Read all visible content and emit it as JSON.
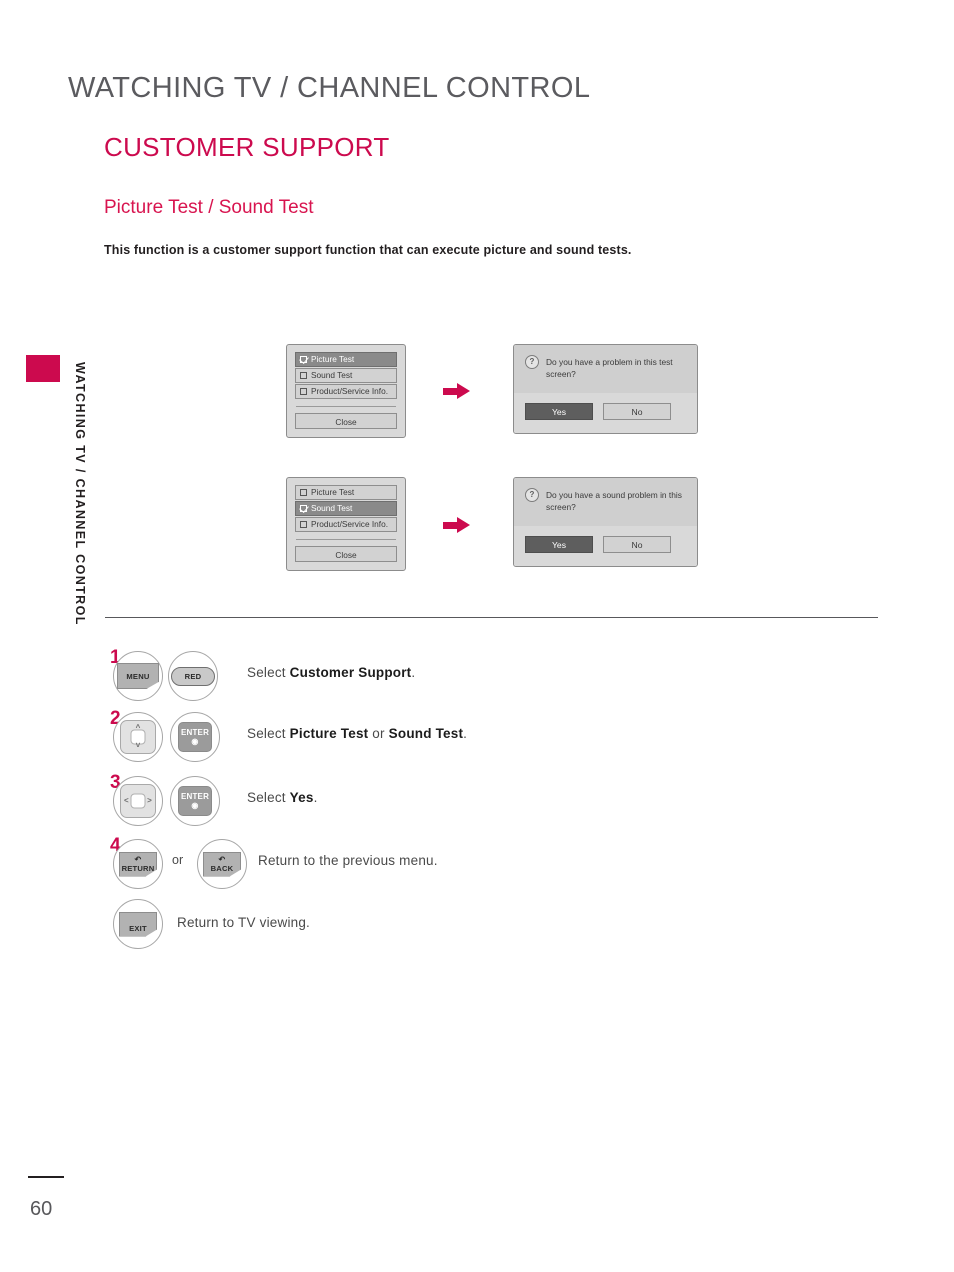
{
  "header": {
    "chapter_title": "WATCHING TV / CHANNEL CONTROL",
    "section_title": "CUSTOMER SUPPORT",
    "sub_title": "Picture Test  / Sound Test",
    "intro_text": "This function is a customer support function that can execute picture and sound tests."
  },
  "sidebar": {
    "label": "WATCHING TV / CHANNEL CONTROL",
    "tab_color": "#cc0a4e"
  },
  "osd": {
    "menu_picture": {
      "rows": [
        {
          "label": "Picture Test",
          "checked": true,
          "selected": true
        },
        {
          "label": "Sound Test",
          "checked": false,
          "selected": false
        },
        {
          "label": "Product/Service Info.",
          "checked": false,
          "selected": false
        }
      ],
      "close_label": "Close"
    },
    "menu_sound": {
      "rows": [
        {
          "label": "Picture Test",
          "checked": false,
          "selected": false
        },
        {
          "label": "Sound Test",
          "checked": true,
          "selected": true
        },
        {
          "label": "Product/Service Info.",
          "checked": false,
          "selected": false
        }
      ],
      "close_label": "Close"
    },
    "dialog_picture": {
      "icon": "question-mark-icon",
      "icon_glyph": "?",
      "message": "Do you have a problem in this test screen?",
      "yes_label": "Yes",
      "no_label": "No"
    },
    "dialog_sound": {
      "icon": "question-mark-icon",
      "icon_glyph": "?",
      "message": "Do you have a sound problem in this screen?",
      "yes_label": "Yes",
      "no_label": "No"
    }
  },
  "steps": [
    {
      "number": "1",
      "keys": [
        {
          "name": "menu-key",
          "label": "MENU",
          "style": "fold"
        },
        {
          "name": "red-key",
          "label": "RED",
          "style": "pill"
        }
      ],
      "text_prefix": "Select ",
      "text_bold_1": "Customer Support",
      "text_mid": "",
      "text_bold_2": "",
      "text_suffix": "."
    },
    {
      "number": "2",
      "keys": [
        {
          "name": "updown-nav-key",
          "label": "",
          "style": "pad-vertical"
        },
        {
          "name": "enter-key",
          "label": "ENTER",
          "style": "enter"
        }
      ],
      "text_prefix": "Select ",
      "text_bold_1": "Picture Test",
      "text_mid": " or ",
      "text_bold_2": "Sound Test",
      "text_suffix": "."
    },
    {
      "number": "3",
      "keys": [
        {
          "name": "leftright-nav-key",
          "label": "",
          "style": "pad-horizontal"
        },
        {
          "name": "enter-key",
          "label": "ENTER",
          "style": "enter"
        }
      ],
      "text_prefix": "Select ",
      "text_bold_1": "Yes",
      "text_mid": "",
      "text_bold_2": "",
      "text_suffix": "."
    },
    {
      "number": "4",
      "keys": [
        {
          "name": "return-key",
          "label": "RETURN",
          "style": "fold-arrow"
        },
        {
          "name": "back-key",
          "label": "BACK",
          "style": "fold-arrow"
        }
      ],
      "or_label": "or",
      "text_plain": "Return to the previous menu."
    },
    {
      "number": "",
      "keys": [
        {
          "name": "exit-key",
          "label": "EXIT",
          "style": "fold"
        }
      ],
      "text_plain": "Return to TV viewing."
    }
  ],
  "step_texts": {
    "step1": "Select Customer Support.",
    "step2": "Select Picture Test or Sound Test.",
    "step3": "Select Yes.",
    "step4": "Return to the previous menu.",
    "step5": "Return to TV viewing.",
    "or": "or"
  },
  "keys": {
    "menu": "MENU",
    "red": "RED",
    "enter": "ENTER",
    "enter_dot": "◉",
    "return": "RETURN",
    "back": "BACK",
    "exit": "EXIT",
    "return_glyph": "↶"
  },
  "footer": {
    "page_number": "60"
  },
  "colors": {
    "accent_pink": "#cc0a4e",
    "heading_grey": "#5b5b5f",
    "body_dark": "#231f20"
  }
}
